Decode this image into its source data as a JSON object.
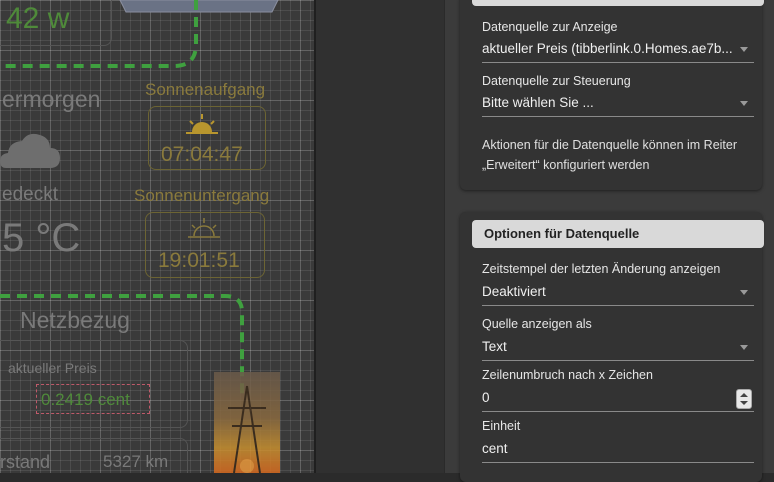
{
  "canvas": {
    "power_value": "42 w",
    "day_label": "ermorgen",
    "sunrise_title": "Sonnenaufgang",
    "sunrise_time": "07:04:47",
    "sunset_title": "Sonnenuntergang",
    "sunset_time": "19:01:51",
    "weather_text": "edeckt",
    "temperature": "5 °C",
    "grid_title": "Netzbezug",
    "price_label": "aktueller Preis",
    "price_value": "0.2419 cent",
    "meter_label": "rstand",
    "meter_value": "5327 km",
    "icons": [
      "cloud-icon",
      "sunrise-icon",
      "sunset-icon",
      "solar-panel-icon",
      "power-pylon-icon"
    ],
    "colors": {
      "flow_line": "#3fa03f",
      "gold_text": "#8a7a3c",
      "green_value": "#4f8a3a"
    }
  },
  "panel": {
    "data_source_card": {
      "display_source_label": "Datenquelle zur Anzeige",
      "display_source_value": "aktueller Preis (tibberlink.0.Homes.ae7b...",
      "control_source_label": "Datenquelle zur Steuerung",
      "control_source_value": "Bitte wählen Sie ...",
      "info_text": "Aktionen für die Datenquelle können im Reiter „Erweitert“ konfiguriert werden"
    },
    "options_card": {
      "title": "Optionen für Datenquelle",
      "timestamp_label": "Zeitstempel der letzten Änderung anzeigen",
      "timestamp_value": "Deaktiviert",
      "display_as_label": "Quelle anzeigen als",
      "display_as_value": "Text",
      "wrap_label": "Zeilenumbruch nach x Zeichen",
      "wrap_value": "0",
      "unit_label": "Einheit",
      "unit_value": "cent"
    }
  }
}
